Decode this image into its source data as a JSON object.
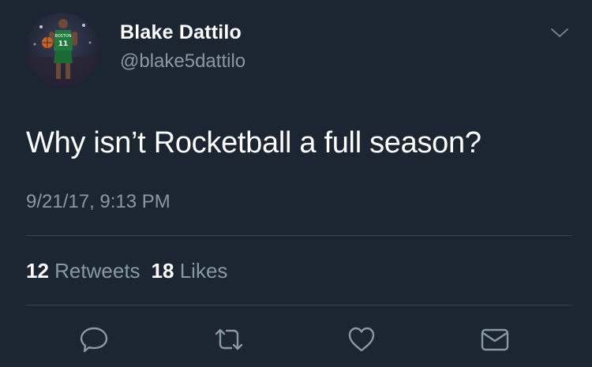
{
  "tweet": {
    "author": {
      "display_name": "Blake Dattilo",
      "handle": "@blake5dattilo",
      "avatar_jersey_text": "BOSTON",
      "avatar_jersey_number": "11"
    },
    "text": "Why isn’t Rocketball a full season?",
    "timestamp": "9/21/17, 9:13 PM",
    "stats": {
      "retweets_count": "12",
      "retweets_label": "Retweets",
      "likes_count": "18",
      "likes_label": "Likes"
    }
  },
  "icons": {
    "more": "chevron-down-icon",
    "reply": "reply-icon",
    "retweet": "retweet-icon",
    "like": "heart-icon",
    "message": "envelope-icon"
  },
  "colors": {
    "background": "#1c2532",
    "primary_text": "#ffffff",
    "secondary_text": "#8899a6",
    "divider": "#38444d",
    "jersey_green": "#1f7a3c"
  }
}
